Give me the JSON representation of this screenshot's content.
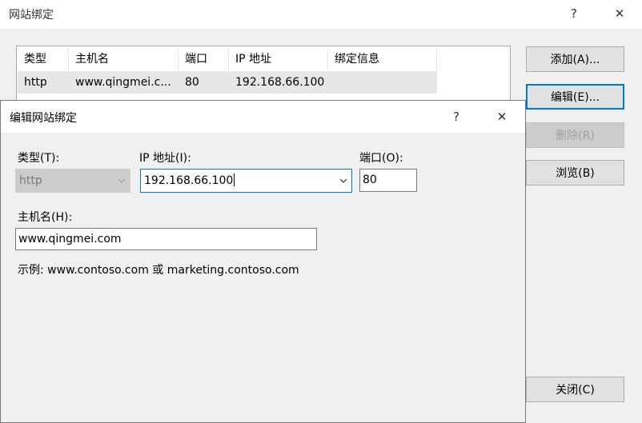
{
  "outer_window": {
    "title": "网站绑定",
    "help_symbol": "?",
    "close_symbol": "✕",
    "table": {
      "headers": [
        "类型",
        "主机名",
        "端口",
        "IP 地址",
        "绑定信息"
      ],
      "rows": [
        [
          "http",
          "www.qingmei.c...",
          "80",
          "192.168.66.100",
          ""
        ]
      ]
    },
    "buttons": {
      "add": "添加(A)...",
      "edit": "编辑(E)...",
      "delete": "删除(R)",
      "browse": "浏览(B)",
      "close": "关闭(C)"
    }
  },
  "dialog": {
    "title": "编辑网站绑定",
    "help_symbol": "?",
    "close_symbol": "✕",
    "type_label": "类型(T):",
    "type_value": "http",
    "ip_label": "IP 地址(I):",
    "ip_value": "192.168.66.100",
    "port_label": "端口(O):",
    "port_value": "80",
    "hostname_label": "主机名(H):",
    "hostname_value": "www.qingmei.com",
    "example_text": "示例: www.contoso.com 或 marketing.contoso.com"
  }
}
